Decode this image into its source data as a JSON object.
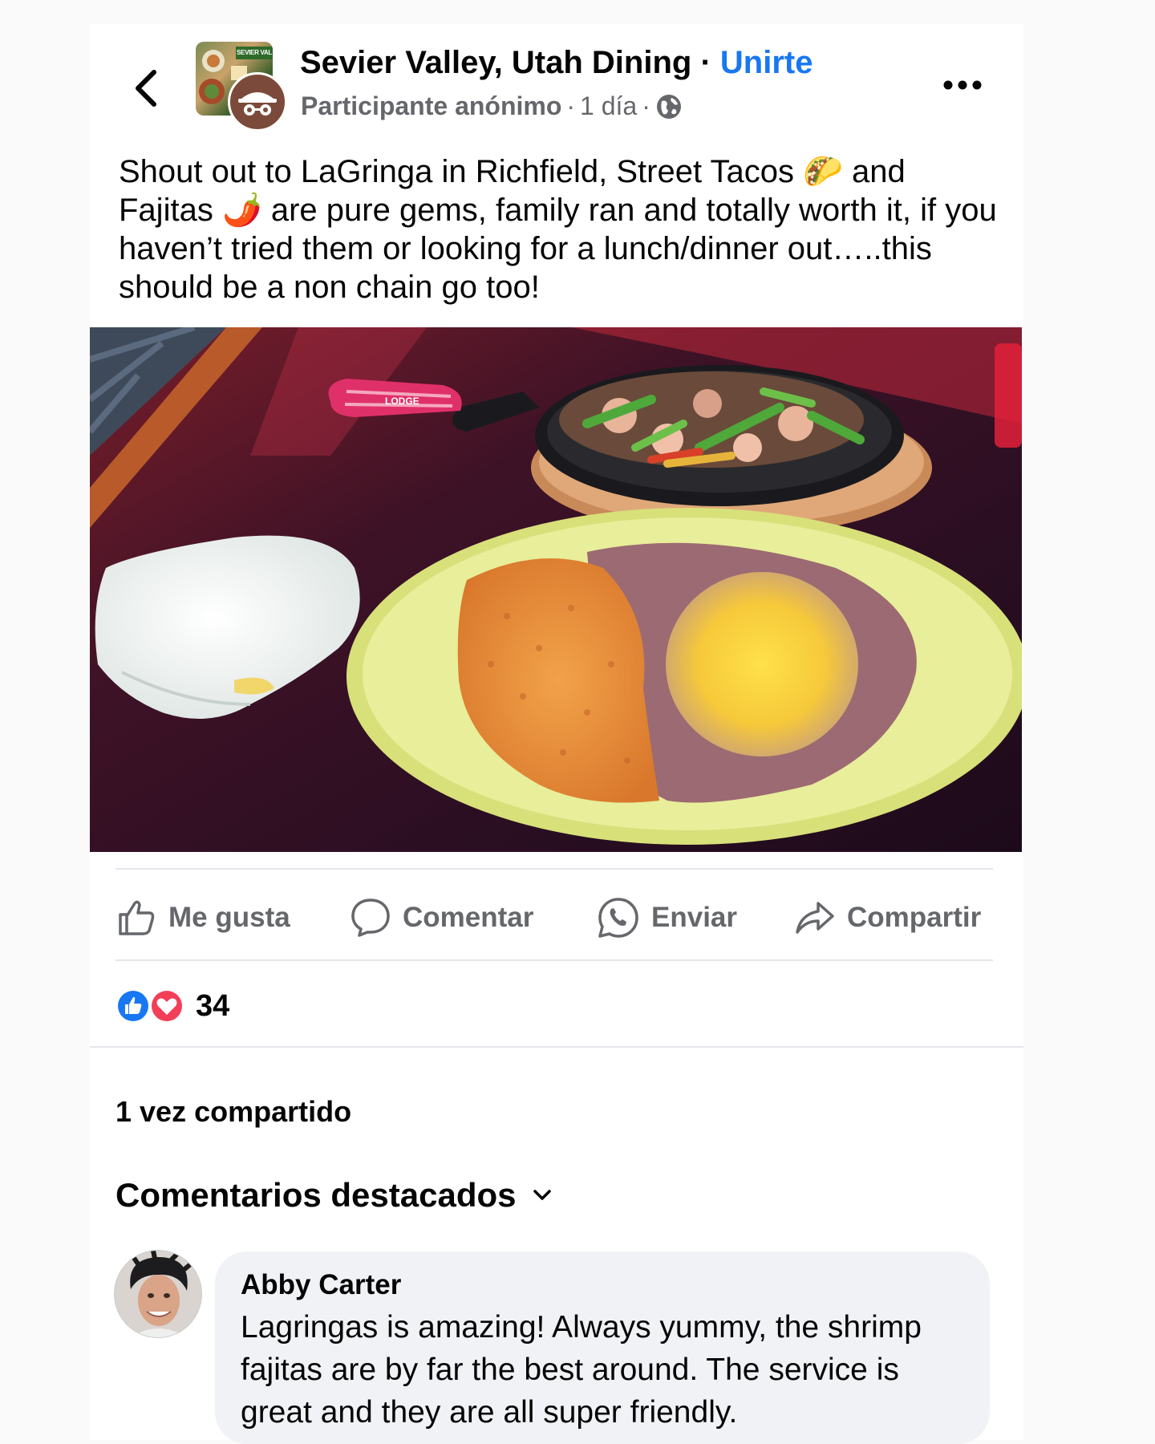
{
  "header": {
    "back_icon": "chevron-left-icon",
    "group_banner_text": "SEVIER VAL",
    "group_name": "Sevier Valley, Utah Dining",
    "separator": "·",
    "join_label": "Unirte",
    "author": "Participante anónimo",
    "time": "1 día",
    "privacy_icon": "globe-icon",
    "more_icon": "more-dots-icon"
  },
  "post": {
    "text_part1": "Shout out to LaGringa in Richfield, Street Tacos ",
    "taco_emoji": "🌮",
    "text_part2": " and Fajitas ",
    "pepper_emoji": "🌶️",
    "text_part3": " are pure gems, family ran and totally worth it, if you haven’t tried them or looking for a lunch/dinner out…..this should be a non chain go too!",
    "skillet_brand": "LODGE"
  },
  "actions": [
    {
      "label": "Me gusta",
      "icon": "thumbs-up-icon"
    },
    {
      "label": "Comentar",
      "icon": "comment-icon"
    },
    {
      "label": "Enviar",
      "icon": "whatsapp-icon"
    },
    {
      "label": "Compartir",
      "icon": "share-icon"
    }
  ],
  "reactions": {
    "count": "34",
    "icons": [
      "like-reaction-icon",
      "love-reaction-icon"
    ],
    "colors": {
      "like": "#1877f2",
      "love": "#f33e58"
    }
  },
  "shares": "1 vez compartido",
  "comments_header": "Comentarios destacados",
  "comment": {
    "author": "Abby Carter",
    "text": "Lagringas is amazing! Always yummy, the shrimp fajitas are by far the best around. The service is great and they are all super friendly."
  },
  "colors": {
    "accent": "#1877f2",
    "muted": "#65676b",
    "bubble": "#f0f2f5"
  }
}
